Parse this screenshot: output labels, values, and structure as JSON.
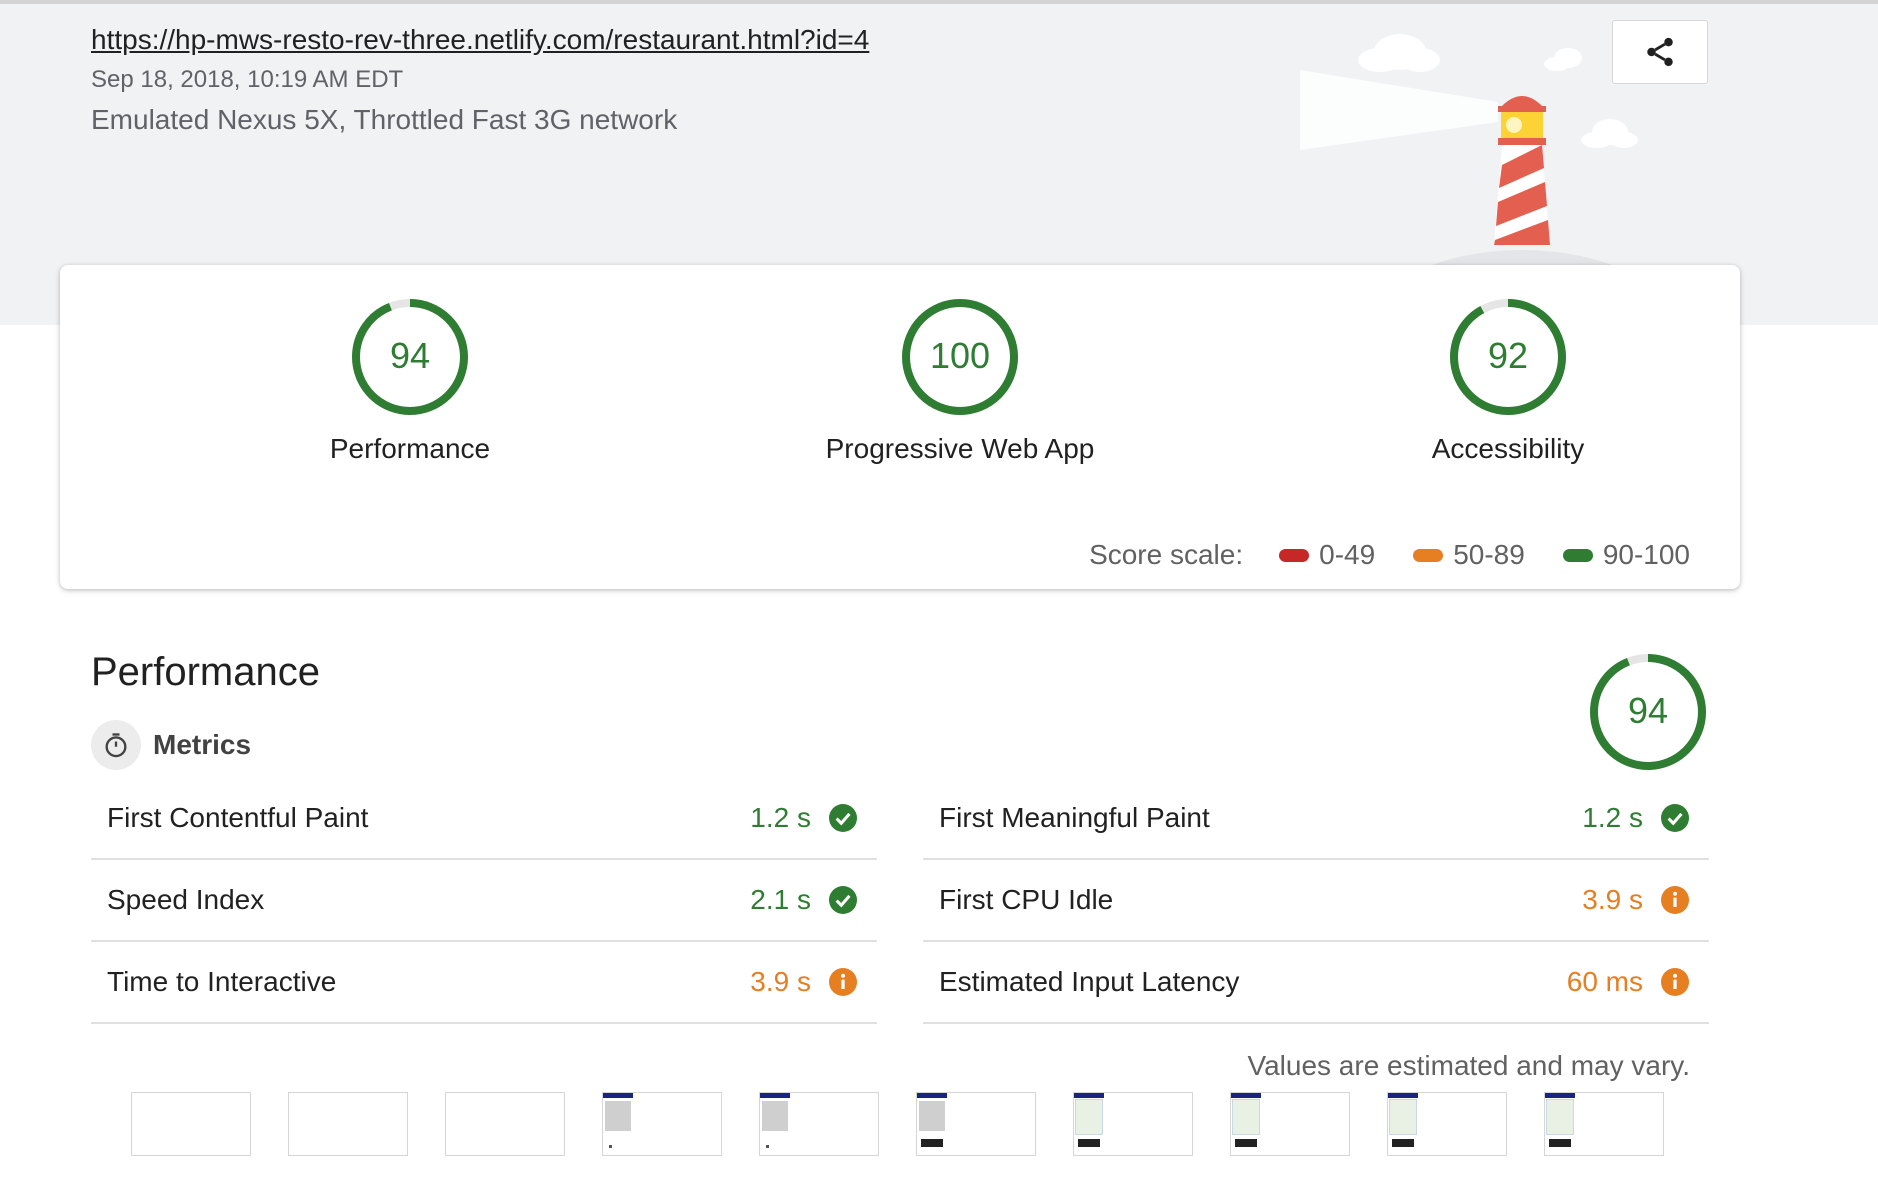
{
  "header": {
    "url": "https://hp-mws-resto-rev-three.netlify.com/restaurant.html?id=4",
    "timestamp": "Sep 18, 2018, 10:19 AM EDT",
    "environment": "Emulated Nexus 5X, Throttled Fast 3G network",
    "share_icon": "share-icon"
  },
  "summary": {
    "gauges": [
      {
        "score": "94",
        "label": "Performance",
        "value": 94
      },
      {
        "score": "100",
        "label": "Progressive Web App",
        "value": 100
      },
      {
        "score": "92",
        "label": "Accessibility",
        "value": 92
      }
    ],
    "scale": {
      "label": "Score scale:",
      "ranges": [
        {
          "text": "0-49",
          "color": "#c62828"
        },
        {
          "text": "50-89",
          "color": "#e67e22"
        },
        {
          "text": "90-100",
          "color": "#2e7d32"
        }
      ]
    }
  },
  "performance": {
    "title": "Performance",
    "score": "94",
    "score_value": 94,
    "metrics_label": "Metrics",
    "metrics": [
      {
        "name": "First Contentful Paint",
        "value": "1.2 s",
        "status": "pass"
      },
      {
        "name": "First Meaningful Paint",
        "value": "1.2 s",
        "status": "pass"
      },
      {
        "name": "Speed Index",
        "value": "2.1 s",
        "status": "pass"
      },
      {
        "name": "First CPU Idle",
        "value": "3.9 s",
        "status": "average"
      },
      {
        "name": "Time to Interactive",
        "value": "3.9 s",
        "status": "average"
      },
      {
        "name": "Estimated Input Latency",
        "value": "60 ms",
        "status": "average"
      }
    ],
    "note": "Values are estimated and may vary.",
    "filmstrip": [
      "blank",
      "blank",
      "blank",
      "loading",
      "loading",
      "loading",
      "map",
      "map",
      "map",
      "map"
    ]
  },
  "colors": {
    "pass": "#2e7d32",
    "average": "#e67e22",
    "fail": "#c62828",
    "header_bg": "#f1f2f4"
  }
}
